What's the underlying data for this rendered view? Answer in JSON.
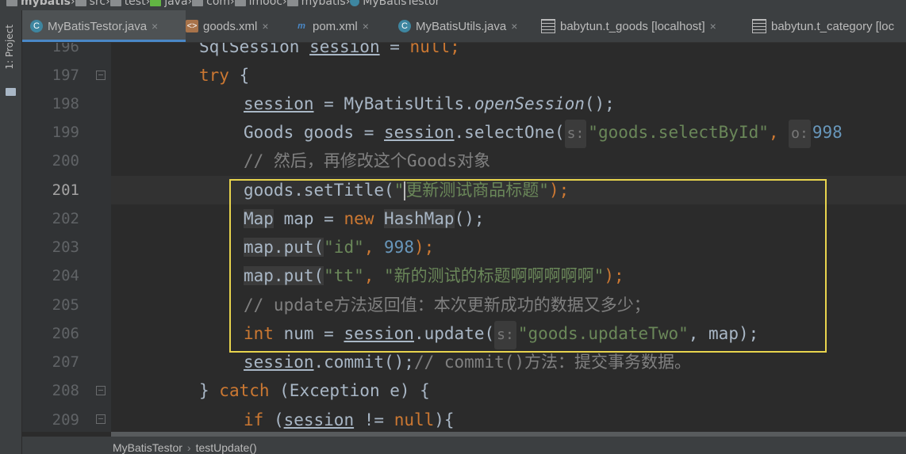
{
  "breadcrumb": {
    "items": [
      "mybatis",
      "src",
      "test",
      "java",
      "com",
      "imooc",
      "mybatis",
      "MyBatisTestor"
    ]
  },
  "left_toolbar": {
    "project_label": "1: Project"
  },
  "tabs": [
    {
      "label": "MyBatisTestor.java",
      "icon": "java-class-icon",
      "active": true
    },
    {
      "label": "goods.xml",
      "icon": "xml-file-icon"
    },
    {
      "label": "pom.xml",
      "icon": "maven-icon"
    },
    {
      "label": "MyBatisUtils.java",
      "icon": "java-class-icon"
    },
    {
      "label": "babytun.t_goods [localhost]",
      "icon": "table-icon"
    },
    {
      "label": "babytun.t_category [loc",
      "icon": "table-icon"
    }
  ],
  "editor": {
    "current_line": 201,
    "lines": [
      {
        "number": 196,
        "text": "SqlSession session = null;"
      },
      {
        "number": 197,
        "text": "try {"
      },
      {
        "number": 198,
        "text": "session = MyBatisUtils.openSession();"
      },
      {
        "number": 199,
        "text": "Goods goods = session.selectOne( s: \"goods.selectById\", o: 998"
      },
      {
        "number": 200,
        "text": "// 然后，再修改这个Goods对象"
      },
      {
        "number": 201,
        "text": "goods.setTitle(\"更新测试商品标题\");"
      },
      {
        "number": 202,
        "text": "Map map = new HashMap();"
      },
      {
        "number": 203,
        "text": "map.put(\"id\", 998);"
      },
      {
        "number": 204,
        "text": "map.put(\"tt\", \"新的测试的标题啊啊啊啊啊\");"
      },
      {
        "number": 205,
        "text": "// update方法返回值：本次更新成功的数据又多少；"
      },
      {
        "number": 206,
        "text": "int num = session.update( s: \"goods.updateTwo\", map);"
      },
      {
        "number": 207,
        "text": "session.commit();// commit()方法：提交事务数据。"
      },
      {
        "number": 208,
        "text": "} catch (Exception e) {"
      },
      {
        "number": 209,
        "text": "if (session != null){"
      }
    ],
    "tokens": {
      "l196": [
        "SqlSession",
        " ",
        "session",
        " = ",
        "null",
        ";"
      ],
      "l197": [
        "try",
        " {"
      ],
      "l198": [
        "session",
        " = MyBatisUtils.",
        "openSession",
        "();"
      ],
      "l199": [
        "Goods goods = ",
        "session",
        ".selectOne(",
        "s:",
        "\"goods.selectById\"",
        ", ",
        "o:",
        "998"
      ],
      "l200": [
        "// 然后，再修改这个Goods对象"
      ],
      "l201": [
        "goods.setTitle(",
        "\"",
        "更新测试商品标题\"",
        ");"
      ],
      "l202": [
        "Map",
        " map = ",
        "new",
        " ",
        "HashMap",
        "();"
      ],
      "l203": [
        "map.put(",
        "\"id\"",
        ", ",
        "998",
        ");"
      ],
      "l204": [
        "map.put(",
        "\"tt\"",
        ", ",
        "\"新的测试的标题啊啊啊啊啊\"",
        ");"
      ],
      "l205": [
        "// update方法返回值：本次更新成功的数据又多少；"
      ],
      "l206": [
        "int",
        " num = ",
        "session",
        ".update(",
        "s:",
        "\"goods.updateTwo\"",
        ", map);"
      ],
      "l207": [
        "session",
        ".commit();",
        "// commit()方法：提交事务数据。"
      ],
      "l208": [
        "} ",
        "catch",
        " (Exception e) {"
      ],
      "l209": [
        "if",
        " (",
        "session",
        " != ",
        "null",
        "){"
      ]
    }
  },
  "status_breadcrumb": {
    "items": [
      "MyBatisTestor",
      "testUpdate()"
    ]
  },
  "colors": {
    "keyword": "#cc7832",
    "string": "#6a8759",
    "number": "#6897bb",
    "comment": "#808080",
    "default": "#a9b7c6",
    "selection_box": "#e8d44d"
  }
}
